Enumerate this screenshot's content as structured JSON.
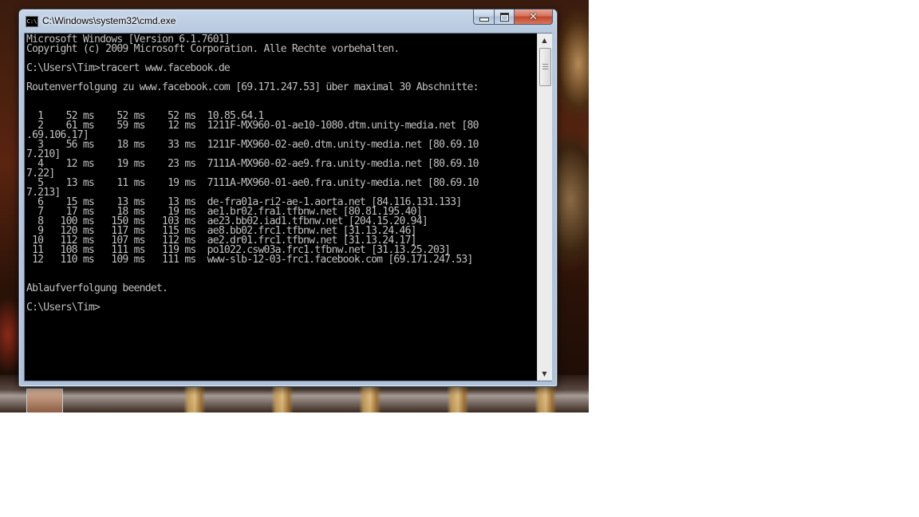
{
  "window": {
    "title": "C:\\Windows\\system32\\cmd.exe",
    "icon_label": "C:\\",
    "controls": {
      "minimize": "minimize-icon",
      "maximize": "maximize-icon",
      "close": "✕"
    }
  },
  "console": {
    "lines": [
      "Microsoft Windows [Version 6.1.7601]",
      "Copyright (c) 2009 Microsoft Corporation. Alle Rechte vorbehalten.",
      "",
      "C:\\Users\\Tim>tracert www.facebook.de",
      "",
      "Routenverfolgung zu www.facebook.com [69.171.247.53] über maximal 30 Abschnitte:",
      "",
      "",
      "  1    52 ms    52 ms    52 ms  10.85.64.1",
      "  2    61 ms    59 ms    12 ms  1211F-MX960-01-ae10-1080.dtm.unity-media.net [80",
      ".69.106.17]",
      "  3    56 ms    18 ms    33 ms  1211F-MX960-02-ae0.dtm.unity-media.net [80.69.10",
      "7.210]",
      "  4    12 ms    19 ms    23 ms  7111A-MX960-02-ae9.fra.unity-media.net [80.69.10",
      "7.22]",
      "  5    13 ms    11 ms    19 ms  7111A-MX960-01-ae0.fra.unity-media.net [80.69.10",
      "7.213]",
      "  6    15 ms    13 ms    13 ms  de-fra01a-ri2-ae-1.aorta.net [84.116.131.133]",
      "  7    17 ms    18 ms    19 ms  ae1.br02.fra1.tfbnw.net [80.81.195.40]",
      "  8   100 ms   150 ms   103 ms  ae23.bb02.iad1.tfbnw.net [204.15.20.94]",
      "  9   120 ms   117 ms   115 ms  ae8.bb02.frc1.tfbnw.net [31.13.24.46]",
      " 10   112 ms   107 ms   112 ms  ae2.dr01.frc1.tfbnw.net [31.13.24.17]",
      " 11   108 ms   111 ms   119 ms  po1022.csw03a.frc1.tfbnw.net [31.13.25.203]",
      " 12   110 ms   109 ms   111 ms  www-slb-12-03-frc1.facebook.com [69.171.247.53]",
      "",
      "",
      "Ablaufverfolgung beendet.",
      "",
      "C:\\Users\\Tim>"
    ],
    "text_color": "#c0c0c0",
    "background": "#000000"
  },
  "scrollbar": {
    "up_arrow": "▲",
    "down_arrow": "▼"
  }
}
